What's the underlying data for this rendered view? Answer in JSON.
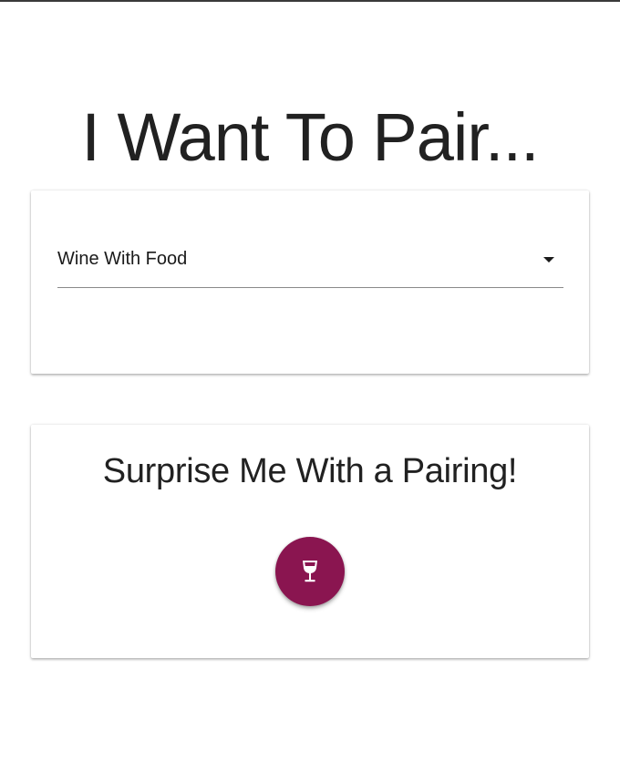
{
  "header": {
    "title": "I Want To Pair..."
  },
  "pairing_select": {
    "selected_value": "Wine With Food"
  },
  "surprise_card": {
    "heading": "Surprise Me With a Pairing!",
    "button_icon": "wine-glass-icon"
  },
  "colors": {
    "accent": "#8a1550",
    "text": "#212121",
    "background": "#ffffff"
  }
}
